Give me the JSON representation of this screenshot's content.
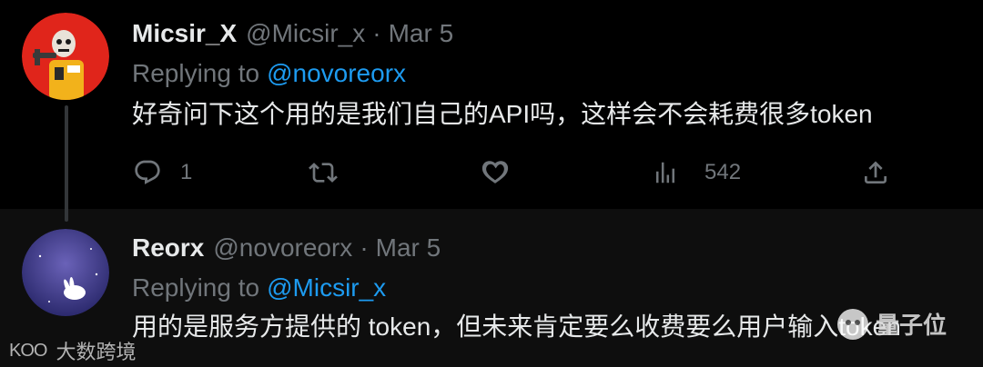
{
  "tweets": [
    {
      "author_name": "Micsir_X",
      "handle": "@Micsir_x",
      "separator": "·",
      "date": "Mar 5",
      "replying_prefix": "Replying to",
      "replying_to": "@novoreorx",
      "text": "好奇问下这个用的是我们自己的API吗，这样会不会耗费很多token",
      "reply_count": "1",
      "view_count": "542"
    },
    {
      "author_name": "Reorx",
      "handle": "@novoreorx",
      "separator": "·",
      "date": "Mar 5",
      "replying_prefix": "Replying to",
      "replying_to": "@Micsir_x",
      "text": "用的是服务方提供的 token，但未来肯定要么收费要么用户输入token"
    }
  ],
  "watermarks": {
    "left_logo": "KOO",
    "left_text": "大数跨境",
    "right_text": "量子位"
  },
  "colors": {
    "background": "#000000",
    "secondary_text": "#71767b",
    "mention": "#1d9bf0",
    "primary_text": "#e7e9ea"
  },
  "icons": [
    "reply-icon",
    "retweet-icon",
    "like-icon",
    "views-icon",
    "share-icon"
  ]
}
